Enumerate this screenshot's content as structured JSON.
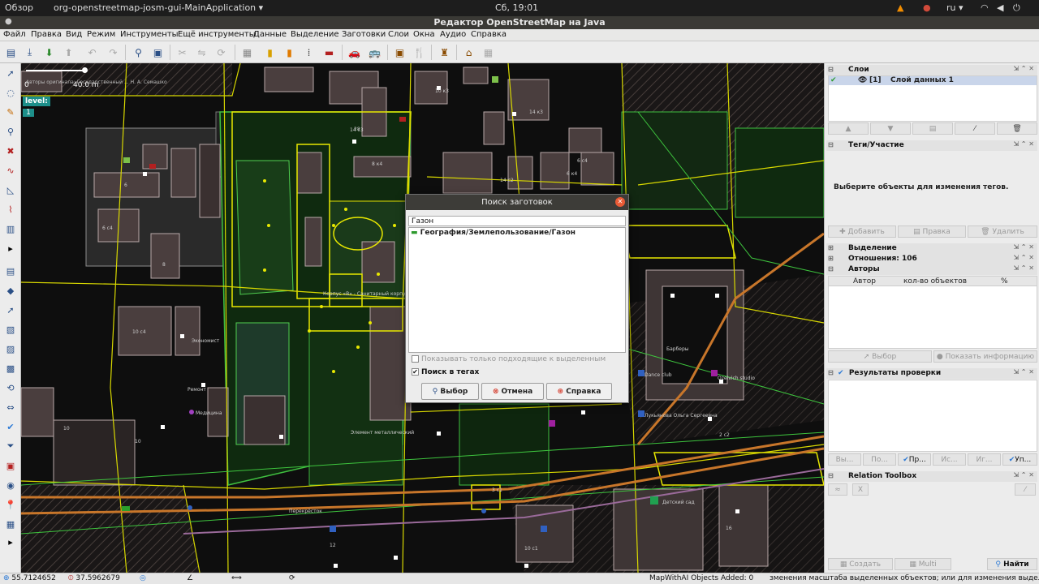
{
  "desktop": {
    "overview": "Обзор",
    "app_menu": "org-openstreetmap-josm-gui-MainApplication",
    "clock": "Сб, 19:01",
    "lang": "ru"
  },
  "window": {
    "title": "Редактор OpenStreetMap на Java"
  },
  "menu": [
    "Файл",
    "Правка",
    "Вид",
    "Режим",
    "Инструменты",
    "Ещё инструменты",
    "Данные",
    "Выделение",
    "Заготовки",
    "Слои",
    "Окна",
    "Аудио",
    "Справка"
  ],
  "map": {
    "scale_min": "0",
    "scale_max": "40.0 m",
    "attribution": "Авторы оригинала: Государственный ... Н. А. Семашко",
    "level_label": "level:",
    "level_value": "1",
    "labels": [
      "10 к3",
      "14 к3",
      "14 с3",
      "8 к4",
      "6 к4",
      "6",
      "8",
      "10 с4",
      "6 с4",
      "10",
      "28",
      "14 с2",
      "6 с4",
      "16",
      "3 с1",
      "2 с2",
      "10 с1",
      "10",
      "12"
    ],
    "poi_labels": [
      "Корпус «В» - Санитарный корпус",
      "Элемент металлический",
      "Перекрёсток",
      "Dance club",
      "Барберы",
      "Ozelvich studio",
      "Лукьянова Ольга Сергеевна",
      "Экономист",
      "Медицина",
      "Ремонт",
      "Детский сад"
    ]
  },
  "panels": {
    "layers": {
      "title": "Слои",
      "item_index": "[1]",
      "item_name": "Слой данных 1"
    },
    "tags": {
      "title": "Теги/Участие",
      "empty": "Выберите объекты для изменения тегов.",
      "add": "Добавить",
      "edit": "Правка",
      "delete": "Удалить"
    },
    "selection": {
      "title": "Выделение"
    },
    "relations": {
      "title": "Отношения: 106"
    },
    "authors": {
      "title": "Авторы",
      "col_author": "Автор",
      "col_count": "кол-во объектов",
      "col_pct": "%"
    },
    "sel_buttons": {
      "select": "Выбор",
      "info": "Показать информацию"
    },
    "validation": {
      "title": "Результаты проверки",
      "buttons": [
        "Вы...",
        "По...",
        "Пр...",
        "Ис...",
        "Иг...",
        "Уп..."
      ]
    },
    "reltoolbox": {
      "title": "Relation Toolbox",
      "x": "X"
    },
    "bottom": {
      "create": "Создать",
      "multi": "Multi",
      "find": "Найти"
    }
  },
  "status": {
    "lat": "55.7124652",
    "lon": "37.5962679",
    "mapwithai": "MapWithAI Objects Added: 0",
    "hint": "зменения масштаба выделенных объектов; или для изменения выделения"
  },
  "dialog": {
    "title": "Поиск заготовок",
    "search_value": "Газон",
    "result": "География/Землепользование/Газон",
    "only_matching": "Показывать только подходящие к выделенным",
    "search_tags": "Поиск в тегах",
    "btn_select": "Выбор",
    "btn_cancel": "Отмена",
    "btn_help": "Справка"
  },
  "colors": {
    "accent": "#1d8f8a",
    "map_bg": "#0f0f0f",
    "osm_yellow": "#e8e800",
    "osm_green": "#2f9a2f",
    "road_orange": "#c8762a"
  }
}
